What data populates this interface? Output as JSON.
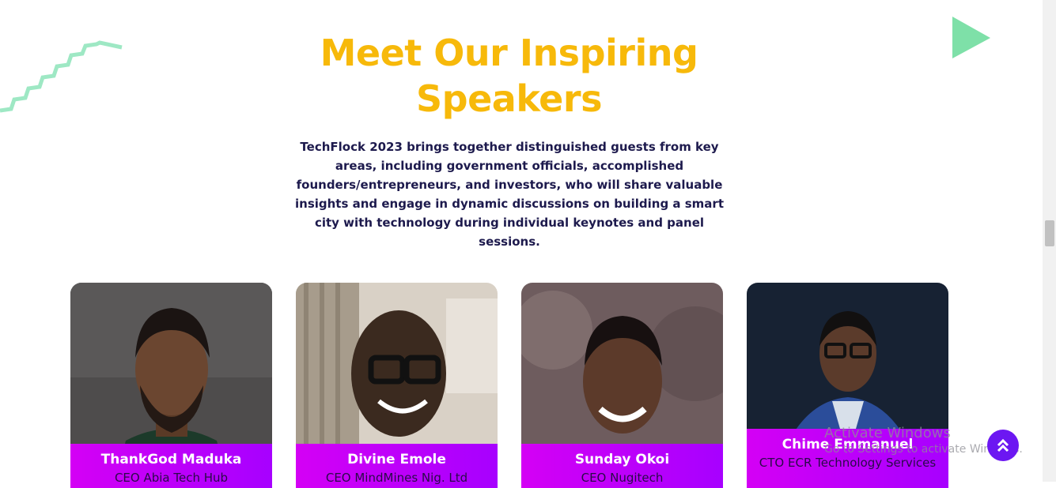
{
  "section": {
    "title_line1": "Meet Our Inspiring",
    "title_line2": "Speakers",
    "description": "TechFlock 2023 brings together distinguished guests from key areas, including government officials, accomplished founders/entrepreneurs, and investors, who will share valuable insights and engage in dynamic discussions on building a smart city with technology during individual keynotes and panel sessions."
  },
  "speakers": [
    {
      "name": "ThankGod Maduka",
      "role": "CEO Abia Tech Hub"
    },
    {
      "name": "Divine Emole",
      "role": "CEO MindMines Nig. Ltd"
    },
    {
      "name": "Sunday Okoi",
      "role": "CEO Nugitech"
    },
    {
      "name": "Chime Emmanuel",
      "role": "CTO ECR Technology Services"
    }
  ],
  "watermark": {
    "line1": "Activate Windows",
    "line2": "Go to Settings to activate Windows."
  },
  "colors": {
    "title": "#f7b90a",
    "text": "#1d1a4d",
    "band_start": "#d400f5",
    "band_end": "#a700ff",
    "accent_green": "#7ee0a8",
    "back_to_top": "#6c17f2"
  },
  "icons": {
    "decor_left": "zigzag-stairs-icon",
    "decor_right": "play-triangle-icon",
    "back_to_top": "double-chevron-up-icon"
  }
}
